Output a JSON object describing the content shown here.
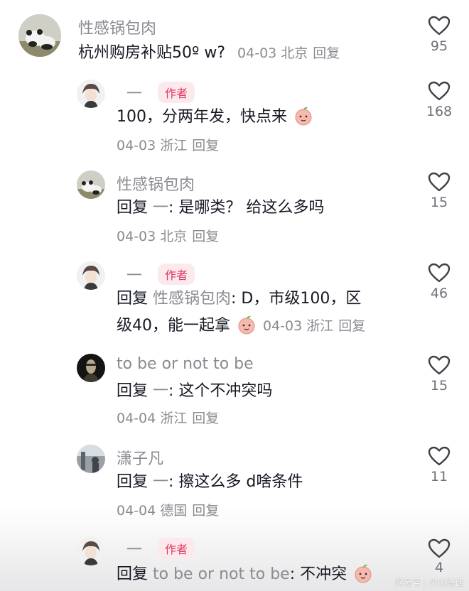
{
  "comments": [
    {
      "name": "性感锅包肉",
      "text": "杭州购房补贴50º w?",
      "meta": "04-03 北京",
      "reply": "回复",
      "likes": "95"
    },
    {
      "name": "一",
      "badge": "作者",
      "text": "100，分两年发，快点来",
      "meta": "04-03 浙江",
      "reply": "回复",
      "likes": "168"
    },
    {
      "name": "性感锅包肉",
      "prefix": "回复",
      "target": "一",
      "text": ": 是哪类？ 给这么多吗",
      "meta": "04-03 北京",
      "reply": "回复",
      "likes": "15"
    },
    {
      "name": "一",
      "badge": "作者",
      "prefix": "回复",
      "target": "性感锅包肉",
      "text_line1": ": D，市级100，区",
      "text_line2": "级40，能一起拿",
      "meta": "04-03 浙江",
      "reply": "回复",
      "likes": "46"
    },
    {
      "name": "to be or not to be",
      "prefix": "回复",
      "target": "一",
      "text": ": 这个不冲突吗",
      "meta": "04-04 浙江",
      "reply": "回复",
      "likes": "15"
    },
    {
      "name": "潇子凡",
      "prefix": "回复",
      "target": "一",
      "text": ": 擦这么多  d啥条件",
      "meta": "04-04 德国",
      "reply": "回复",
      "likes": "11"
    },
    {
      "name": "一",
      "badge": "作者",
      "prefix": "回复",
      "target": "to be or not to be",
      "text": ": 不冲突",
      "likes": "4"
    }
  ],
  "icons": {
    "like": "heart-outline-icon",
    "emoji": "peach-emoji-icon"
  },
  "watermark": "网易号 | 火山诗话"
}
